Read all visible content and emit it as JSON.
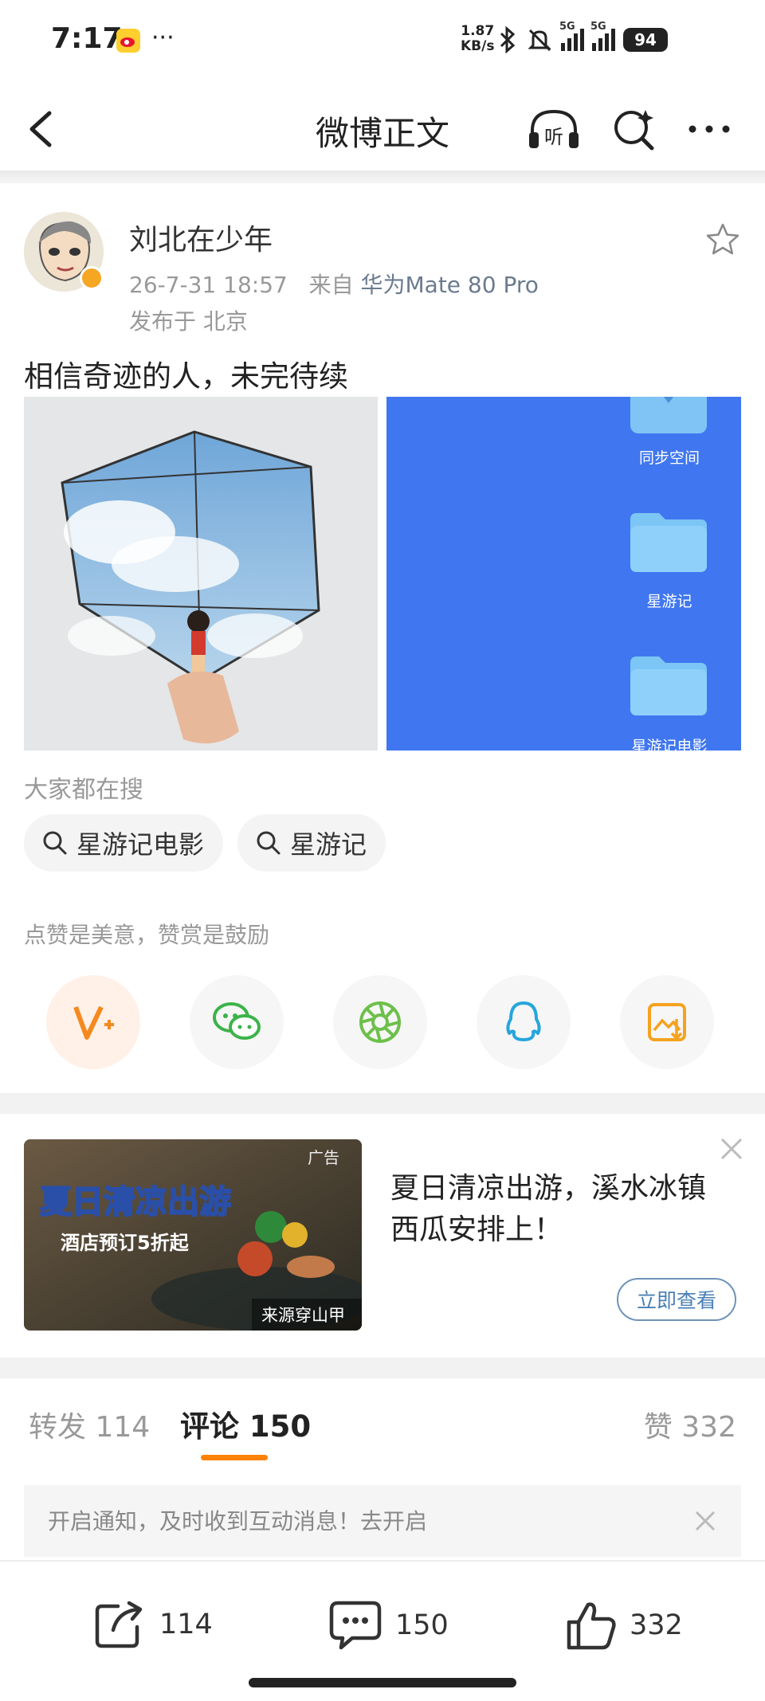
{
  "status_bar": {
    "time": "7:17",
    "more": "···",
    "net_speed_value": "1.87",
    "net_speed_unit": "KB/s",
    "sim1": "5G",
    "sim2": "5G",
    "battery": "94"
  },
  "nav": {
    "title": "微博正文",
    "listen_label": "听"
  },
  "post": {
    "username": "刘北在少年",
    "date": "26-7-31 18:57",
    "source_prefix": "来自",
    "source_device": "华为Mate 80 Pro",
    "location": "发布于 北京",
    "text": "相信奇迹的人，未完待续",
    "image2_labels": [
      "同步空间",
      "星游记",
      "星游记电影"
    ]
  },
  "search": {
    "hint": "大家都在搜",
    "chips": [
      "星游记电影",
      "星游记"
    ]
  },
  "share": {
    "hint": "点赞是美意，赞赏是鼓励",
    "icons": [
      "v-plus-icon",
      "wechat-icon",
      "moments-icon",
      "qq-icon",
      "save-image-icon"
    ]
  },
  "ad": {
    "image_title": "夏日清凉出游",
    "image_subtitle": "酒店预订5折起",
    "badge": "广告",
    "source": "来源穿山甲",
    "text": "夏日清凉出游，溪水冰镇西瓜安排上！",
    "button": "立即查看"
  },
  "tabs": {
    "repost": "转发 114",
    "comment": "评论 150",
    "like": "赞 332"
  },
  "notification": {
    "text": "开启通知，及时收到互动消息！去开启"
  },
  "bottom_bar": {
    "repost_count": "114",
    "comment_count": "150",
    "like_count": "332"
  },
  "colors": {
    "accent": "#ff8200",
    "link": "#4a7fb5",
    "desktop_blue": "#4077f0"
  }
}
